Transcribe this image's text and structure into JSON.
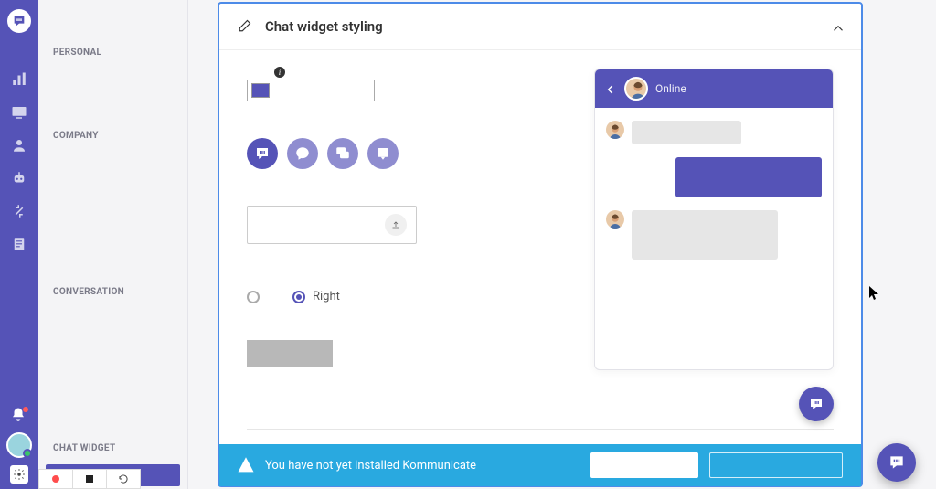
{
  "sidebar_sections": [
    "PERSONAL",
    "COMPANY",
    "CONVERSATION",
    "CHAT WIDGET"
  ],
  "card": {
    "title": "Chat widget styling",
    "position_right": "Right"
  },
  "preview": {
    "status": "Online"
  },
  "banner": {
    "text": "You have not yet installed Kommunicate"
  },
  "icons": {
    "rail": [
      "analytics-icon",
      "monitor-icon",
      "user-icon",
      "bot-icon",
      "integrations-icon",
      "report-icon"
    ]
  },
  "colors": {
    "primary": "#5553b7",
    "banner": "#29a9e0"
  }
}
